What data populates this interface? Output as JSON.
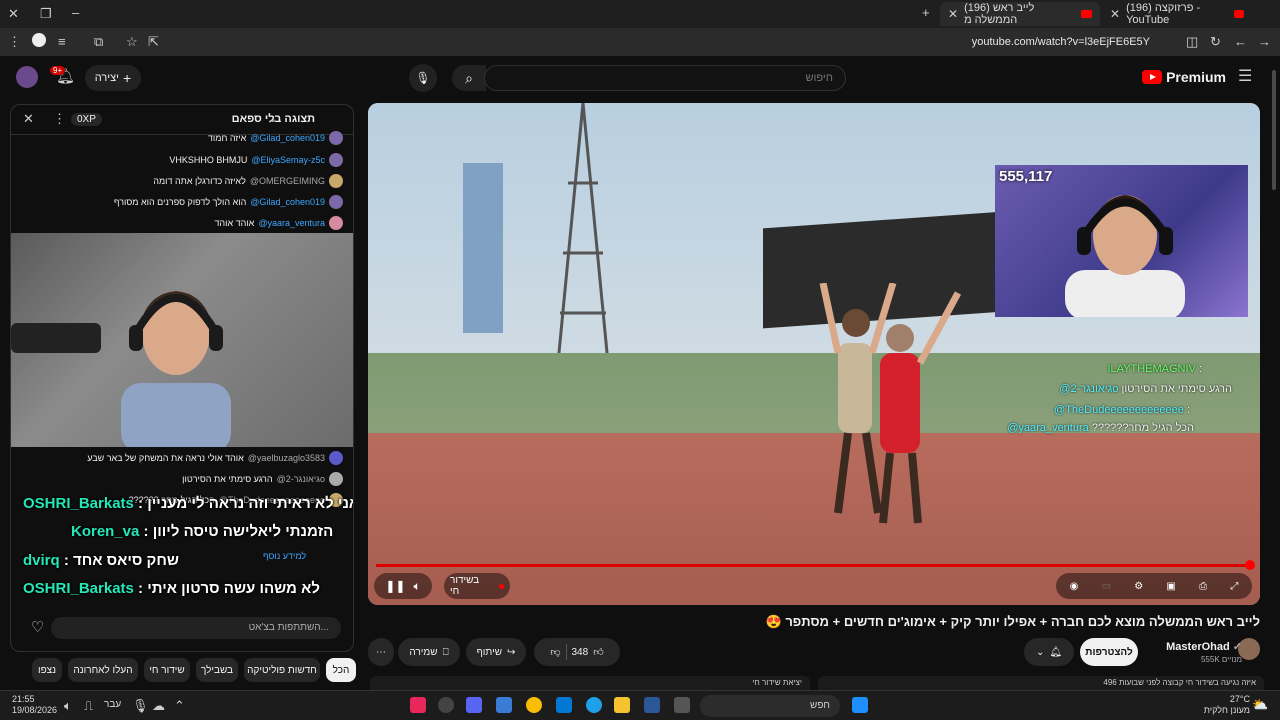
{
  "browser": {
    "tabs": [
      {
        "label": "(196) פרזוקצה - YouTube",
        "active": false
      },
      {
        "label": "(196) לייב ראש הממשלה מ",
        "active": true
      }
    ],
    "url": "youtube.com/watch?v=l3eEjFE6E5Y"
  },
  "header": {
    "search_placeholder": "חיפוש",
    "logo_text": "Premium",
    "create_label": "יצירה",
    "notif_count": "9+"
  },
  "chat": {
    "title": "תצוגה בלי ספאם",
    "xp": "0XP",
    "messages_top": [
      {
        "author": "@Gilad_cohen019",
        "text": "איזה חמוד",
        "badge": "#2"
      },
      {
        "author": "@EliyaSemay-z5c",
        "text": "VHKSHHO BHMJU"
      },
      {
        "author": "@OMERGEIMING",
        "text": "לאיזה כדורגלן אתה דומה"
      },
      {
        "author": "@Gilad_cohen019",
        "text": "הוא הולך לדפוק ספרנים הוא מסורף",
        "badge": "#2"
      },
      {
        "author": "@yaara_ventura",
        "text": "אוהד אוהד"
      }
    ],
    "messages_bottom": [
      {
        "author": "@yaelbuzaglo3583",
        "text": "אוהד אולי נראה את המשחק של באר שבע"
      },
      {
        "author": "@גיאונגר-2o",
        "text": "הרגע סימתי את הסירטון"
      },
      {
        "author": "@TheDudeeeeeeeeeeeee",
        "text": "?????? הכל הגיל מחר"
      }
    ],
    "overlay": [
      {
        "name": "OSHRI_Barkats",
        "text": "אני לא ראיתי וזה נראה לי מעניין"
      },
      {
        "name": "Koren_va",
        "text": "הזמנתי ליאלישה טיסה ליוון"
      },
      {
        "name": "dvirq",
        "text": "שחק סיאס אחד"
      },
      {
        "name": "OSHRI_Barkats",
        "text": "לא משהו עשה סרטון איתי"
      }
    ],
    "learn_more": "למידע נוסף",
    "input_placeholder": "השתתפות בצ'אט..."
  },
  "chips": [
    "הכל",
    "חדשות פוליטיקה",
    "בשבילך",
    "שידור חי",
    "העלו לאחרונה",
    "נצפו"
  ],
  "player": {
    "viewer_count": "555,117",
    "live_label": "בשידור חי",
    "overlay_chat": [
      {
        "name": "ILAYTHEMAGNIV",
        "text": ":"
      },
      {
        "name": "@גיאונגר-2o",
        "text": "הרגע סימתי את הסירטון"
      },
      {
        "name": "@TheDudeeeeeeeeeeeee",
        "text": ":"
      },
      {
        "name": "@yaara_ventura",
        "text": "??????הכל הגיל מחר"
      }
    ],
    "progress": 1.0
  },
  "video": {
    "title": "לייב ראש הממשלה מוצא לכם חברה + אפילו יותר קיק + אימוג'ים חדשים + מסתפר 😍",
    "channel": "MasterOhad",
    "subs": "555K מנויים",
    "subscribe_label": "להצטרפות",
    "likes": "348",
    "share_label": "שיתוף",
    "save_label": "שמירה",
    "recs": [
      "יציאת שידור חי",
      "496 איזה נגיעה בשידור חי קבוצה לפני שבועות"
    ]
  },
  "taskbar": {
    "time": "21:55",
    "date": "19/08/2026",
    "lang": "עבר",
    "search": "חפש",
    "weather_temp": "27°C",
    "weather_desc": "מעונן חלקית"
  },
  "colors": {
    "accent": "#ff0000",
    "bg": "#0f0f0f",
    "chip_active": "#f1f1f1"
  }
}
